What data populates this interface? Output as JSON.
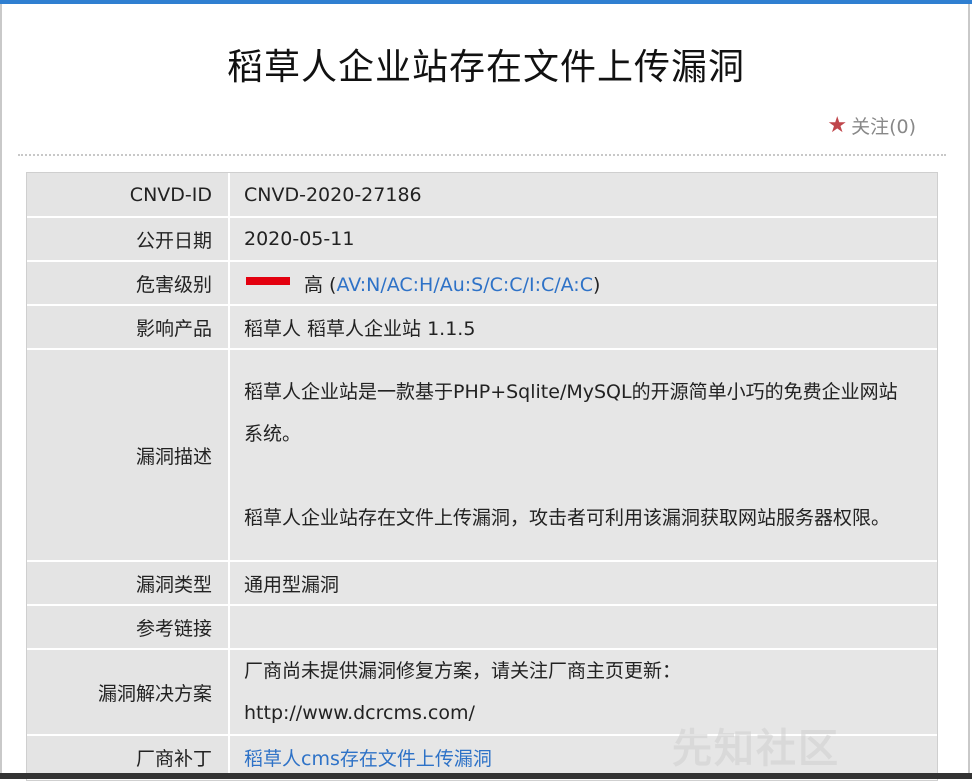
{
  "page": {
    "title": "稻草人企业站存在文件上传漏洞",
    "follow_label": "关注(0)"
  },
  "details": {
    "cnvd_id": {
      "label": "CNVD-ID",
      "value": "CNVD-2020-27186"
    },
    "publish_date": {
      "label": "公开日期",
      "value": "2020-05-11"
    },
    "severity": {
      "label": "危害级别",
      "level": "高",
      "vector": "AV:N/AC:H/Au:S/C:C/I:C/A:C",
      "color": "#e3000f"
    },
    "products": {
      "label": "影响产品",
      "value": "稻草人 稻草人企业站 1.1.5"
    },
    "description": {
      "label": "漏洞描述",
      "para1": "稻草人企业站是一款基于PHP+Sqlite/MySQL的开源简单小巧的免费企业网站系统。",
      "para2": "稻草人企业站存在文件上传漏洞，攻击者可利用该漏洞获取网站服务器权限。"
    },
    "vuln_type": {
      "label": "漏洞类型",
      "value": "通用型漏洞"
    },
    "references": {
      "label": "参考链接",
      "value": ""
    },
    "solution": {
      "label": "漏洞解决方案",
      "line1": "厂商尚未提供漏洞修复方案，请关注厂商主页更新：",
      "line2": "http://www.dcrcms.com/"
    },
    "patch": {
      "label": "厂商补丁",
      "value": "稻草人cms存在文件上传漏洞"
    }
  },
  "watermark": "先知社区"
}
